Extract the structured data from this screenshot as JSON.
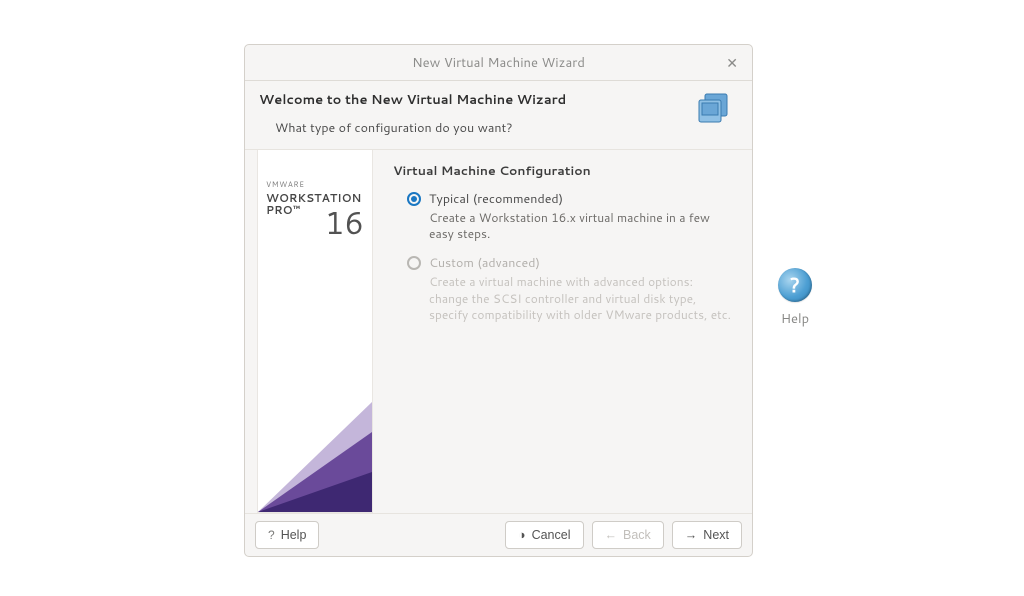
{
  "dialog": {
    "title": "New Virtual Machine Wizard",
    "header_title": "Welcome to the New Virtual Machine Wizard",
    "header_subtitle": "What type of configuration do you want?"
  },
  "banner": {
    "brand": "VMWARE",
    "product_line1": "WORKSTATION",
    "product_line2": "PRO™",
    "version": "16"
  },
  "config": {
    "section_label": "Virtual Machine Configuration",
    "options": [
      {
        "label": "Typical (recommended)",
        "desc": "Create a Workstation 16.x virtual machine in a few easy steps.",
        "selected": true,
        "enabled": true
      },
      {
        "label": "Custom (advanced)",
        "desc": "Create a virtual machine with advanced options: change the SCSI controller and virtual disk type, specify compatibility with older VMware products, etc.",
        "selected": false,
        "enabled": false
      }
    ]
  },
  "footer": {
    "help": "Help",
    "cancel": "Cancel",
    "back": "Back",
    "next": "Next"
  },
  "desktop": {
    "help_label": "Help"
  }
}
